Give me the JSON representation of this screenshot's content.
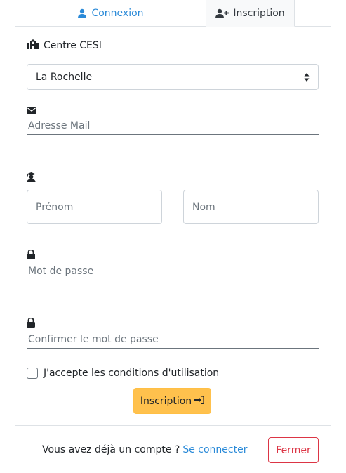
{
  "tabs": {
    "login_label": "Connexion",
    "signup_label": "Inscription"
  },
  "form": {
    "center_label": "Centre CESI",
    "center_selected": "La Rochelle",
    "email_placeholder": "Adresse Mail",
    "firstname_placeholder": "Prénom",
    "lastname_placeholder": "Nom",
    "password_placeholder": "Mot de passe",
    "confirm_password_placeholder": "Confirmer le mot de passe",
    "terms_label": "J'accepte les conditions d'utilisation",
    "submit_label": "Inscription"
  },
  "footer": {
    "question": "Vous avez déjà un compte ?",
    "login_link": "Se connecter",
    "close_label": "Fermer"
  },
  "colors": {
    "accent_blue": "#2a8ad8",
    "submit_yellow": "#ffc14d",
    "danger": "#dc3545"
  },
  "icons": {
    "login_tab": "user-icon",
    "signup_tab": "user-plus-icon",
    "center": "school-icon",
    "email": "envelope-icon",
    "name": "graduate-icon",
    "password": "lock-icon",
    "submit": "sign-in-icon"
  }
}
